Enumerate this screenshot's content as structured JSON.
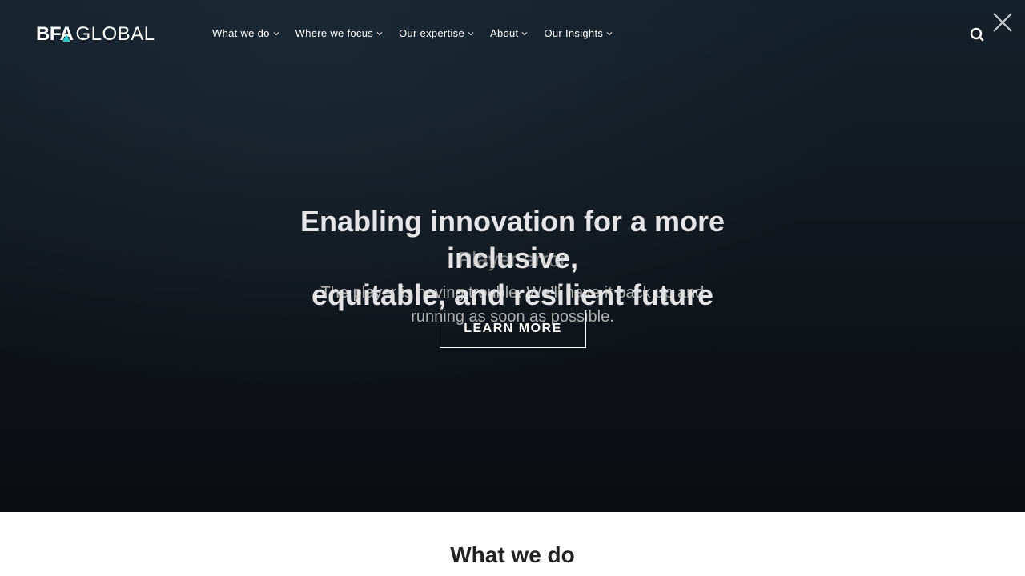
{
  "header": {
    "logo_bold": "BFA",
    "logo_light": "GLOBAL",
    "nav": [
      {
        "label": "What we do"
      },
      {
        "label": "Where we focus"
      },
      {
        "label": "Our expertise"
      },
      {
        "label": "About"
      },
      {
        "label": "Our Insights"
      }
    ]
  },
  "hero": {
    "title_line1": "Enabling innovation for a more inclusive,",
    "title_line2": "equitable, and resilient future",
    "cta_label": "LEARN MORE"
  },
  "player_error": {
    "title": "Player error",
    "message": "The player is having trouble. We’ll have it back up and running as soon as possible."
  },
  "section": {
    "title": "What we do"
  },
  "colors": {
    "hero_bg": "#121a22",
    "accent": "#2cc5c9",
    "text_light": "#ffffff",
    "section_text": "#222222"
  },
  "icons": {
    "search": "search-icon",
    "close": "close-icon",
    "chevron": "chevron-down-icon"
  }
}
